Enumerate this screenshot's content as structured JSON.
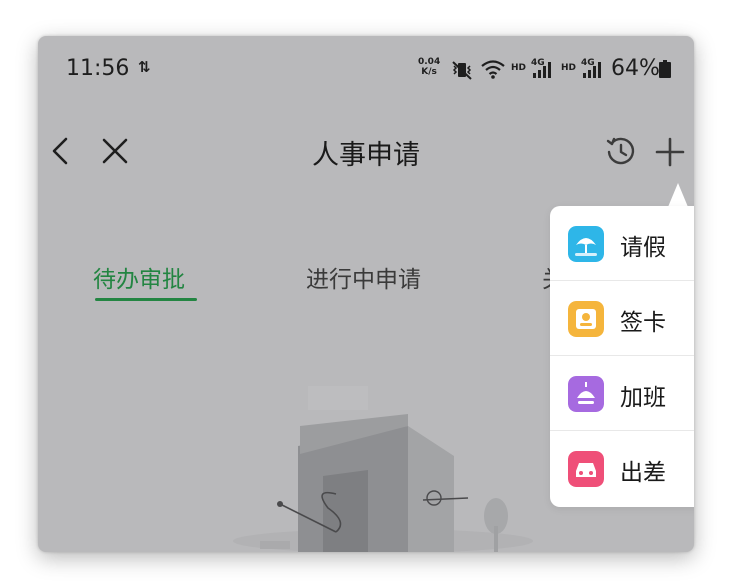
{
  "status_bar": {
    "time": "11:56",
    "data_arrows": "⇅",
    "net_speed_value": "0.04",
    "net_speed_unit": "K/s",
    "signal1_label": "HD",
    "signal1_gen": "4G",
    "signal2_label": "HD",
    "signal2_gen": "4G",
    "battery": "64%"
  },
  "nav": {
    "title": "人事申请",
    "back_icon": "chevron-left",
    "close_icon": "x",
    "history_icon": "clock-history",
    "add_icon": "plus"
  },
  "tabs": [
    {
      "label": "待办审批",
      "active": true
    },
    {
      "label": "进行中申请",
      "active": false
    },
    {
      "label": "关",
      "active": false
    }
  ],
  "popup_menu": {
    "items": [
      {
        "label": "请假",
        "icon": "umbrella-icon",
        "color": "#2eb6e8"
      },
      {
        "label": "签卡",
        "icon": "card-icon",
        "color": "#f5b53c"
      },
      {
        "label": "加班",
        "icon": "lamp-icon",
        "color": "#a66ae0"
      },
      {
        "label": "出差",
        "icon": "car-icon",
        "color": "#ef4f78"
      }
    ]
  },
  "colors": {
    "accent": "#238542",
    "overlay": "#b9b9bb"
  }
}
